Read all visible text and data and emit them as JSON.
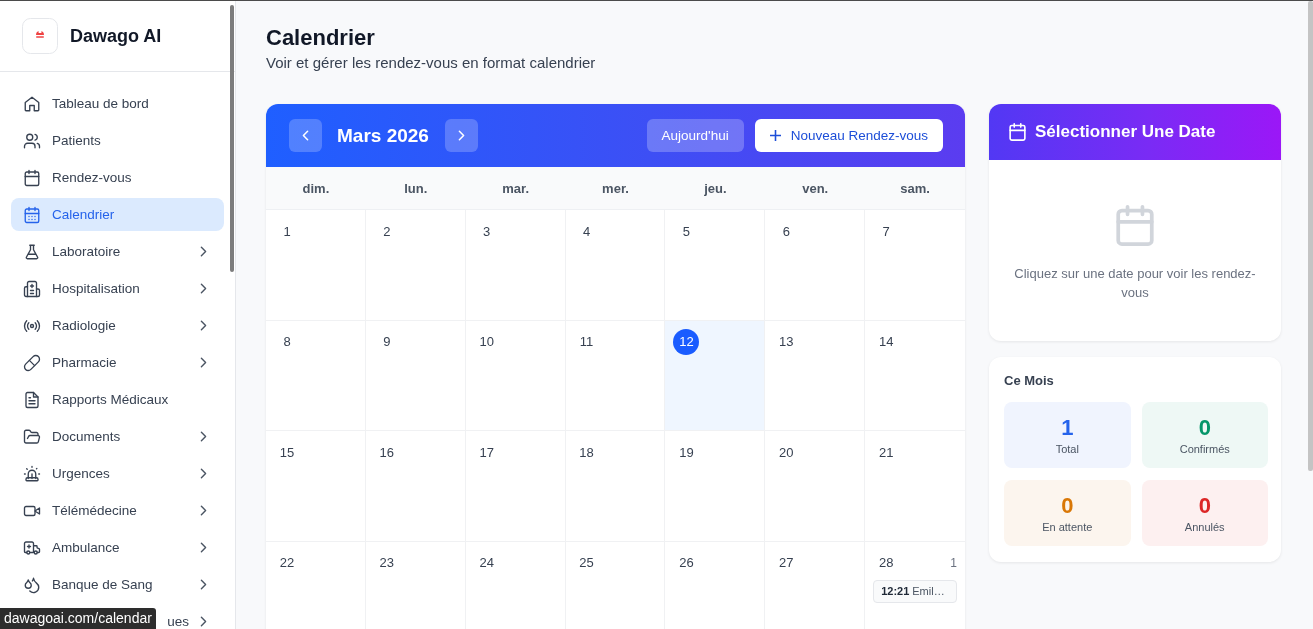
{
  "sidebar": {
    "brand": "Dawago AI",
    "items": [
      {
        "label": "Tableau de bord",
        "selected": false,
        "expandable": false,
        "covered": false
      },
      {
        "label": "Patients",
        "selected": false,
        "expandable": false,
        "covered": false
      },
      {
        "label": "Rendez-vous",
        "selected": false,
        "expandable": false,
        "covered": false
      },
      {
        "label": "Calendrier",
        "selected": true,
        "expandable": false,
        "covered": false
      },
      {
        "label": "Laboratoire",
        "selected": false,
        "expandable": true,
        "covered": false
      },
      {
        "label": "Hospitalisation",
        "selected": false,
        "expandable": true,
        "covered": false
      },
      {
        "label": "Radiologie",
        "selected": false,
        "expandable": true,
        "covered": false
      },
      {
        "label": "Pharmacie",
        "selected": false,
        "expandable": true,
        "covered": false
      },
      {
        "label": "Rapports Médicaux",
        "selected": false,
        "expandable": false,
        "covered": false
      },
      {
        "label": "Documents",
        "selected": false,
        "expandable": true,
        "covered": false
      },
      {
        "label": "Urgences",
        "selected": false,
        "expandable": true,
        "covered": false
      },
      {
        "label": "Télémédecine",
        "selected": false,
        "expandable": true,
        "covered": false
      },
      {
        "label": "Ambulance",
        "selected": false,
        "expandable": true,
        "covered": false
      },
      {
        "label": "Banque de Sang",
        "selected": false,
        "expandable": true,
        "covered": false
      },
      {
        "label": "ues",
        "selected": false,
        "expandable": true,
        "covered": true
      }
    ]
  },
  "status_url": "dawagoai.com/calendar",
  "page": {
    "title": "Calendrier",
    "subtitle": "Voir et gérer les rendez-vous en format calendrier"
  },
  "calendar": {
    "month": "Mars 2026",
    "today_button": "Aujourd'hui",
    "new_button": "Nouveau Rendez-vous",
    "weekdays": [
      "dim.",
      "lun.",
      "mar.",
      "mer.",
      "jeu.",
      "ven.",
      "sam."
    ],
    "days": [
      {
        "number": "1",
        "today": false
      },
      {
        "number": "2",
        "today": false
      },
      {
        "number": "3",
        "today": false
      },
      {
        "number": "4",
        "today": false
      },
      {
        "number": "5",
        "today": false
      },
      {
        "number": "6",
        "today": false
      },
      {
        "number": "7",
        "today": false
      },
      {
        "number": "8",
        "today": false
      },
      {
        "number": "9",
        "today": false
      },
      {
        "number": "10",
        "today": false
      },
      {
        "number": "11",
        "today": false
      },
      {
        "number": "12",
        "today": true
      },
      {
        "number": "13",
        "today": false
      },
      {
        "number": "14",
        "today": false
      },
      {
        "number": "15",
        "today": false
      },
      {
        "number": "16",
        "today": false
      },
      {
        "number": "17",
        "today": false
      },
      {
        "number": "18",
        "today": false
      },
      {
        "number": "19",
        "today": false
      },
      {
        "number": "20",
        "today": false
      },
      {
        "number": "21",
        "today": false
      },
      {
        "number": "22",
        "today": false
      },
      {
        "number": "23",
        "today": false
      },
      {
        "number": "24",
        "today": false
      },
      {
        "number": "25",
        "today": false
      },
      {
        "number": "26",
        "today": false
      },
      {
        "number": "27",
        "today": false
      },
      {
        "number": "28",
        "today": false,
        "count": "1",
        "events": [
          {
            "time": "12:21",
            "title": "Emil…"
          }
        ]
      }
    ]
  },
  "date_panel": {
    "title": "Sélectionner Une Date",
    "message": "Cliquez sur une date pour voir les rendez-vous"
  },
  "month_stats": {
    "title": "Ce Mois",
    "tiles": [
      {
        "value": "1",
        "label": "Total",
        "color": "#2563eb"
      },
      {
        "value": "0",
        "label": "Confirmés",
        "color": "#059669"
      },
      {
        "value": "0",
        "label": "En attente",
        "color": "#d97706"
      },
      {
        "value": "0",
        "label": "Annulés",
        "color": "#dc2626"
      }
    ]
  }
}
